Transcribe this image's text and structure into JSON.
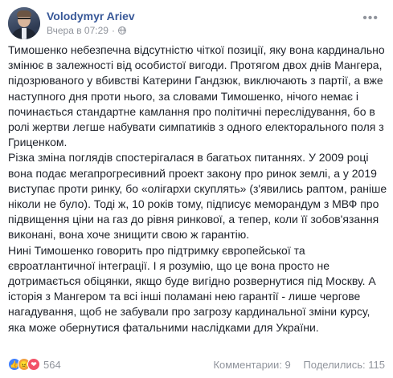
{
  "post": {
    "author": "Volodymyr Ariev",
    "timestamp": "Вчера в 07:29",
    "audience_dot": "·",
    "more_icon": "more-icon",
    "paragraphs": [
      "Тимошенко небезпечна відсутністю чіткої позиції, яку вона кардинально змінює в залежності від особистої вигоди. Протягом двох днів Мангера, підозрюваного у вбивстві Катерини Гандзюк, виключають з партії, а вже наступного дня проти нього, за словами Тимошенко, нічого немає і починається стандартне камлання про політичні переслідування, бо в ролі жертви легше набувати симпатиків з одного електорального поля з Гриценком.",
      "Різка зміна поглядів спостерігалася в багатьох питаннях. У 2009 році вона подає мегапрогресивний проект закону про ринок землі, а у 2019 виступає проти ринку, бо «олігархи скуплять» (з'явились раптом, раніше ніколи не було). Тоді ж, 10 років тому, підписує меморандум з МВФ про підвищення ціни на газ до рівня ринкової, а тепер, коли її зобов'язання виконані, вона хоче знищити свою ж гарантію.",
      "Нині Тимошенко говорить про підтримку європейської та євроатлантичної інтеграції. І я розумію, що це вона просто не дотримається обіцянки, якщо буде вигідно розвернутися під Москву. А історія з Мангером та всі інші поламані нею гарантії - лише чергове нагадування, щоб не забували про загрозу кардинальної зміни курсу, яка може обернутися фатальними наслідками для України."
    ]
  },
  "footer": {
    "reaction_count": "564",
    "comments": "Комментарии: 9",
    "shares": "Поделились: 115",
    "reactions": [
      {
        "name": "like-reaction-icon",
        "glyph": "👍"
      },
      {
        "name": "angry-reaction-icon",
        "glyph": "😠"
      },
      {
        "name": "love-reaction-icon",
        "glyph": "❤"
      }
    ]
  }
}
